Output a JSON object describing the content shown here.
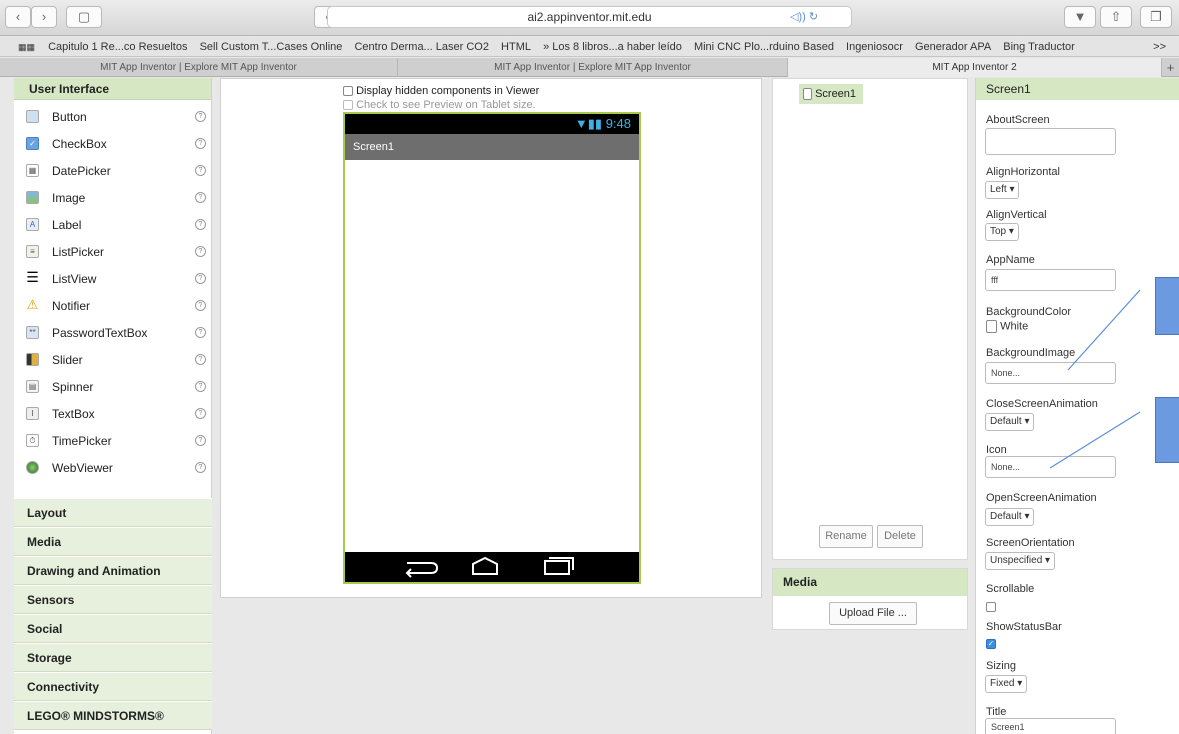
{
  "browser": {
    "url": "ai2.appinventor.mit.edu",
    "url_icons": "◁)) ↻"
  },
  "bookmarks": [
    "Capitulo 1 Re...co Resueltos",
    "Sell Custom T...Cases Online",
    "Centro Derma... Laser CO2",
    "HTML",
    "» Los 8 libros...a haber leído",
    "Mini CNC Plo...rduino Based",
    "Ingeniosocr",
    "Generador APA",
    "Bing Traductor",
    ">>"
  ],
  "tabs": [
    "MIT App Inventor | Explore MIT App Inventor",
    "MIT App Inventor | Explore MIT App Inventor",
    "MIT App Inventor 2",
    "+"
  ],
  "palette": {
    "header": "User Interface",
    "help": "?",
    "items": [
      {
        "label": "Button",
        "icon": "button-icon"
      },
      {
        "label": "CheckBox",
        "icon": "checkbox-icon"
      },
      {
        "label": "DatePicker",
        "icon": "calendar-icon"
      },
      {
        "label": "Image",
        "icon": "image-icon"
      },
      {
        "label": "Label",
        "icon": "label-icon"
      },
      {
        "label": "ListPicker",
        "icon": "list-icon"
      },
      {
        "label": "ListView",
        "icon": "listview-icon"
      },
      {
        "label": "Notifier",
        "icon": "warning-icon"
      },
      {
        "label": "PasswordTextBox",
        "icon": "password-icon"
      },
      {
        "label": "Slider",
        "icon": "slider-icon"
      },
      {
        "label": "Spinner",
        "icon": "spinner-icon"
      },
      {
        "label": "TextBox",
        "icon": "textbox-icon"
      },
      {
        "label": "TimePicker",
        "icon": "clock-icon"
      },
      {
        "label": "WebViewer",
        "icon": "globe-icon"
      }
    ],
    "categories": [
      "Layout",
      "Media",
      "Drawing and Animation",
      "Sensors",
      "Social",
      "Storage",
      "Connectivity",
      "LEGO® MINDSTORMS®"
    ]
  },
  "viewer": {
    "hidden_label": "Display hidden components in Viewer",
    "tablet_label": "Check to see Preview on Tablet size.",
    "time": "9:48",
    "screen_title": "Screen1"
  },
  "components": {
    "tree_item": "Screen1",
    "rename": "Rename",
    "delete": "Delete"
  },
  "media": {
    "header": "Media",
    "upload": "Upload File ..."
  },
  "properties": {
    "header": "Screen1",
    "about": "AboutScreen",
    "alignh": "AlignHorizontal",
    "alignh_val": "Left ▾",
    "alignv": "AlignVertical",
    "alignv_val": "Top ▾",
    "appname": "AppName",
    "appname_val": "fff",
    "bgcolor": "BackgroundColor",
    "bgcolor_val": "White",
    "bgimage": "BackgroundImage",
    "bgimage_val": "None...",
    "closeanim": "CloseScreenAnimation",
    "closeanim_val": "Default ▾",
    "icon": "Icon",
    "icon_val": "None...",
    "openanim": "OpenScreenAnimation",
    "openanim_val": "Default ▾",
    "orient": "ScreenOrientation",
    "orient_val": "Unspecified ▾",
    "scrollable": "Scrollable",
    "statusbar": "ShowStatusBar",
    "sizing": "Sizing",
    "sizing_val": "Fixed ▾",
    "title": "Title",
    "title_val": "Screen1"
  }
}
